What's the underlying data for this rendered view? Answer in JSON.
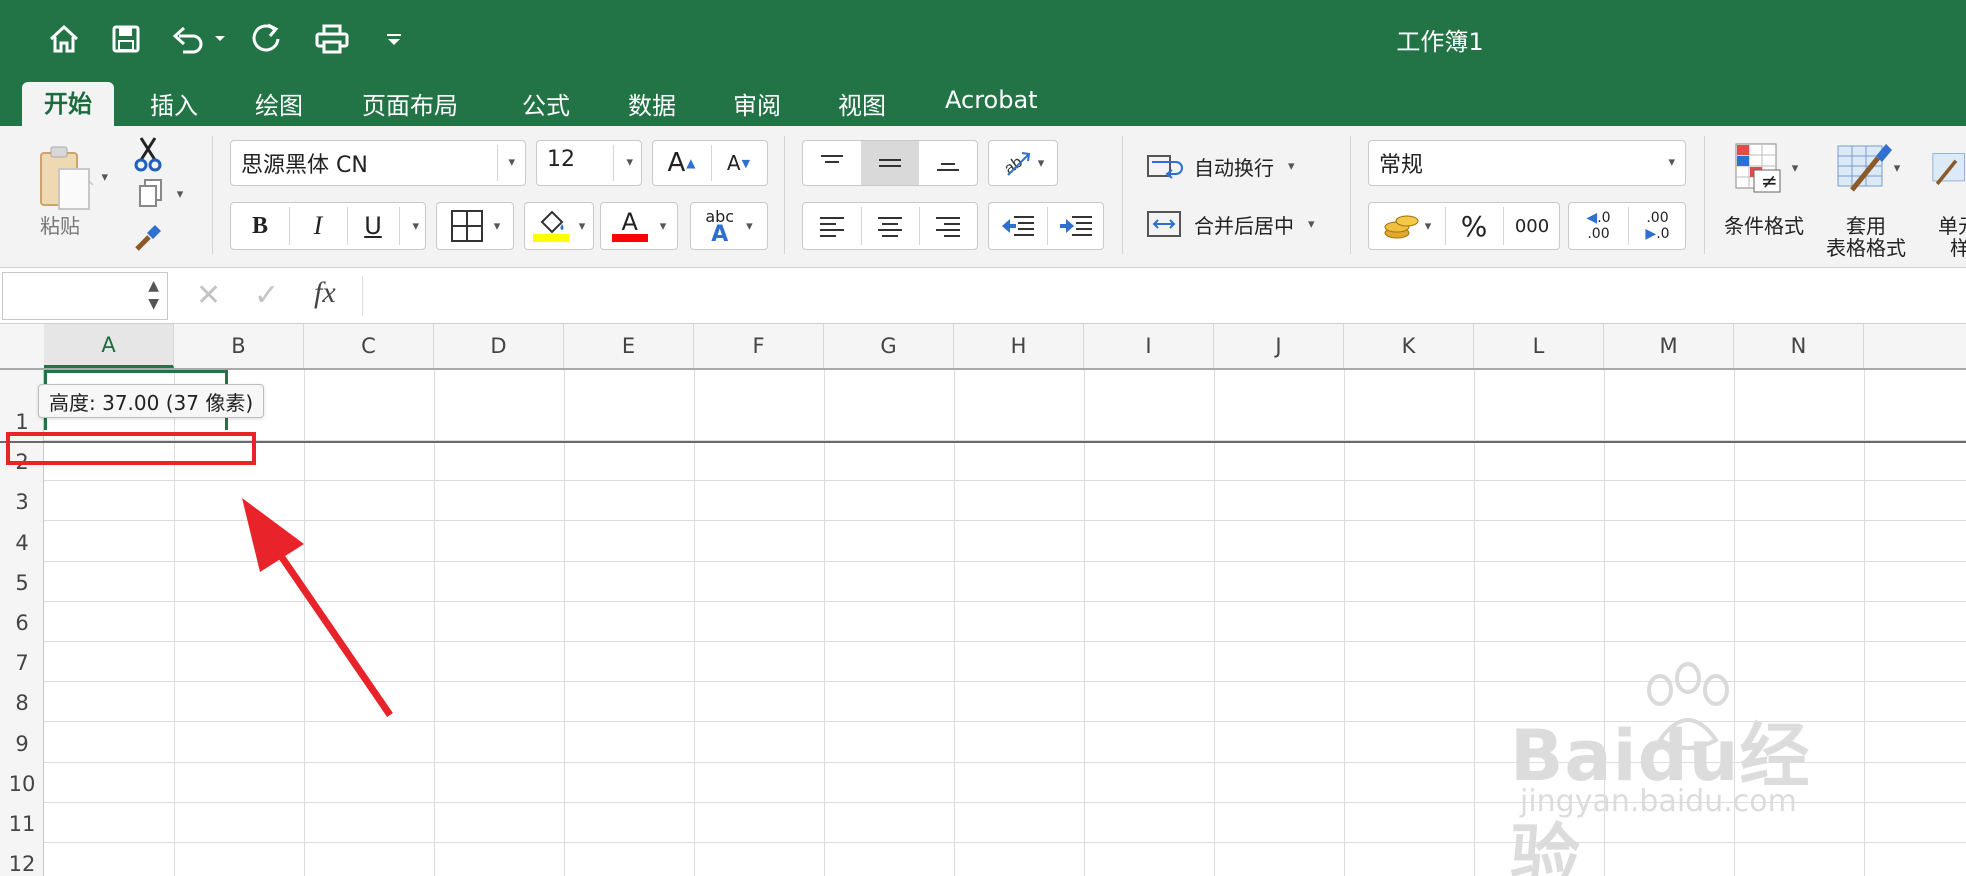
{
  "window": {
    "title": "工作簿1"
  },
  "quick_access": {
    "icons": [
      "home-icon",
      "save-icon",
      "undo-icon",
      "redo-icon",
      "print-icon",
      "customize-icon"
    ]
  },
  "tabs": [
    {
      "label": "开始",
      "active": true
    },
    {
      "label": "插入"
    },
    {
      "label": "绘图"
    },
    {
      "label": "页面布局"
    },
    {
      "label": "公式"
    },
    {
      "label": "数据"
    },
    {
      "label": "审阅"
    },
    {
      "label": "视图"
    },
    {
      "label": "Acrobat"
    }
  ],
  "ribbon": {
    "paste_label": "粘贴",
    "font_name": "思源黑体 CN",
    "font_size": "12",
    "grow_font": "A",
    "shrink_font": "A",
    "bold": "B",
    "italic": "I",
    "underline": "U",
    "font_color_letter": "A",
    "phonetic_top": "abc",
    "phonetic_bottom": "A",
    "wrap_text": "自动换行",
    "merge_center": "合并后居中",
    "number_format": "常规",
    "percent": "%",
    "thousands": "000",
    "inc_decimal_top": ".0",
    "inc_decimal_bottom": ".00",
    "dec_decimal_top": ".00",
    "dec_decimal_bottom": ".0",
    "cond_format": "条件格式",
    "table_format_1": "套用",
    "table_format_2": "表格格式",
    "cell_style_1": "单元",
    "cell_style_2": "样",
    "colors": {
      "highlight": "#ffff00",
      "font": "#ff0000",
      "accent": "#227446"
    }
  },
  "formula_bar": {
    "name_box_value": "",
    "cancel": "✕",
    "enter": "✓",
    "fx": "fx",
    "formula_value": ""
  },
  "sheet": {
    "columns": [
      "A",
      "B",
      "C",
      "D",
      "E",
      "F",
      "G",
      "H",
      "I",
      "J",
      "K",
      "L",
      "M",
      "N"
    ],
    "rows": [
      "1",
      "2",
      "3",
      "4",
      "5",
      "6",
      "7",
      "8",
      "9",
      "10",
      "11",
      "12"
    ],
    "selected_column": "A"
  },
  "tooltip": {
    "text": "高度: 37.00 (37 像素)"
  },
  "watermark": {
    "brand": "Baidu经验",
    "url": "jingyan.baidu.com"
  }
}
